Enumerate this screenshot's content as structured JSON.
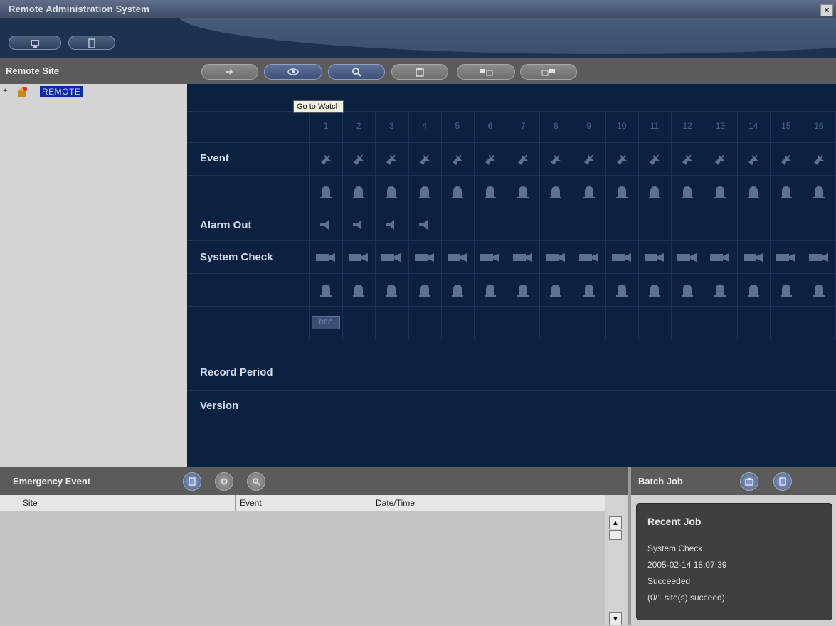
{
  "window": {
    "title": "Remote Administration System",
    "close_label": "×"
  },
  "top_toolbar": {
    "buttons": [
      {
        "icon": "site-icon"
      },
      {
        "icon": "device-icon"
      }
    ]
  },
  "left_panel": {
    "title": "Remote Site",
    "tree": {
      "expander": "+",
      "icon": "site-node-icon",
      "label": "REMOTE"
    }
  },
  "toolbar": {
    "buttons": [
      {
        "icon": "login-icon"
      },
      {
        "icon": "watch-icon",
        "tooltip": "Go to Watch"
      },
      {
        "icon": "search-icon"
      },
      {
        "icon": "toolbox-icon"
      },
      {
        "icon": "transfer-icon"
      },
      {
        "icon": "transfer-back-icon"
      }
    ]
  },
  "tooltip": "Go to Watch",
  "status_grid": {
    "columns": [
      "1",
      "2",
      "3",
      "4",
      "5",
      "6",
      "7",
      "8",
      "9",
      "10",
      "11",
      "12",
      "13",
      "14",
      "15",
      "16"
    ],
    "rows": {
      "event": "Event",
      "alarm_out": "Alarm Out",
      "system_check": "System Check",
      "record_period": "Record Period",
      "version": "Version"
    },
    "alarm_out_count": 4,
    "rec_badge": "REC"
  },
  "emergency_event": {
    "title": "Emergency Event",
    "columns": [
      "Site",
      "Event",
      "Date/Time"
    ],
    "rows": []
  },
  "batch_job": {
    "title": "Batch Job",
    "recent_job": {
      "title": "Recent Job",
      "name": "System Check",
      "datetime": "2005-02-14 18:07:39",
      "status": "Succeeded",
      "summary": "(0/1 site(s) succeed)"
    }
  },
  "colors": {
    "panel_bg": "#0b2142",
    "selection": "#0a2a9f",
    "header_bg": "#5b5b5b"
  }
}
